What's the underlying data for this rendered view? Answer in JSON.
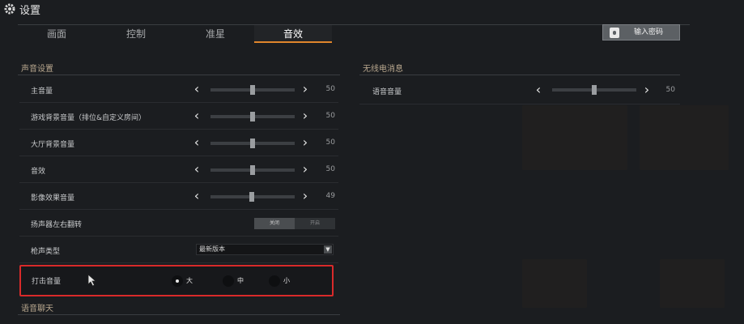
{
  "app": {
    "title": "设置"
  },
  "tabs": [
    {
      "label": "画面"
    },
    {
      "label": "控制"
    },
    {
      "label": "准星"
    },
    {
      "label": "音效"
    }
  ],
  "active_tab": "音效",
  "password_button": {
    "label": "输入密码"
  },
  "sound_section": {
    "title": "声音设置",
    "sliders": [
      {
        "label": "主音量",
        "value": "50",
        "level": 0.5
      },
      {
        "label": "游戏背景音量（排位&自定义房间）",
        "value": "50",
        "level": 0.5
      },
      {
        "label": "大厅背景音量",
        "value": "50",
        "level": 0.5
      },
      {
        "label": "音效",
        "value": "50",
        "level": 0.5
      },
      {
        "label": "影像效果音量",
        "value": "49",
        "level": 0.49
      }
    ],
    "speaker_flip": {
      "label": "扬声器左右翻转",
      "off_label": "关闭",
      "on_label": "开启",
      "selected": "off"
    },
    "gun_sound": {
      "label": "枪声类型",
      "selected": "最新版本"
    },
    "hit_sound": {
      "label": "打击音量",
      "options": [
        {
          "label": "大",
          "selected": true
        },
        {
          "label": "中",
          "selected": false
        },
        {
          "label": "小",
          "selected": false
        }
      ]
    }
  },
  "voice_chat_section": {
    "title": "语音聊天"
  },
  "radio_section": {
    "title": "无线电消息",
    "slider": {
      "label": "语音音量",
      "value": "50",
      "level": 0.5
    }
  },
  "colors": {
    "accent": "#e0862c",
    "highlight": "#d92a2a"
  }
}
